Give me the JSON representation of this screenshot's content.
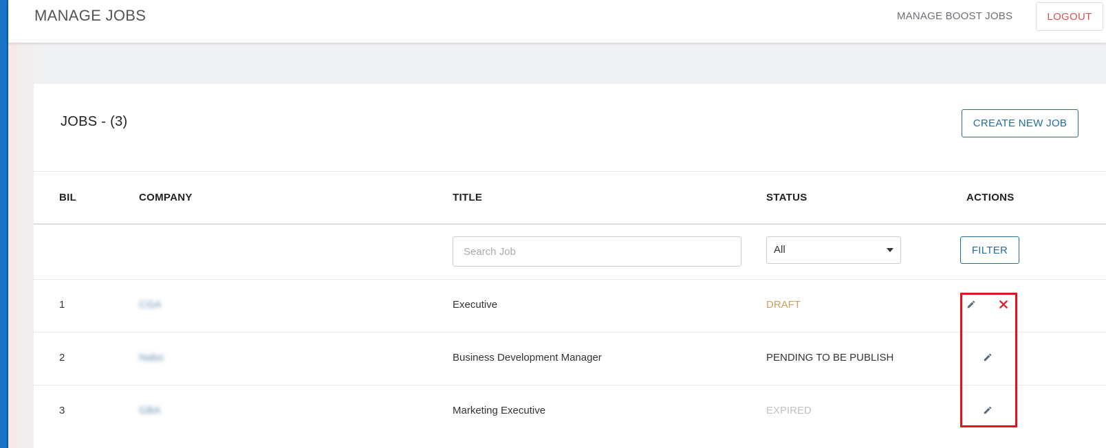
{
  "header": {
    "title": "MANAGE JOBS",
    "nav_boost": "MANAGE BOOST JOBS",
    "logout": "LOGOUT"
  },
  "jobs": {
    "heading": "JOBS - (3)",
    "create_button": "CREATE NEW JOB",
    "columns": {
      "bil": "BIL",
      "company": "COMPANY",
      "title": "TITLE",
      "status": "STATUS",
      "actions": "ACTIONS"
    },
    "filters": {
      "search_placeholder": "Search Job",
      "status_selected": "All",
      "filter_button": "FILTER"
    },
    "rows": [
      {
        "bil": "1",
        "company": "CGA",
        "title": "Executive",
        "status": "DRAFT",
        "actions": [
          "edit-icon",
          "delete-icon"
        ]
      },
      {
        "bil": "2",
        "company": "Nabo",
        "title": "Business Development Manager",
        "status": "PENDING TO BE PUBLISH",
        "actions": [
          "edit-icon"
        ]
      },
      {
        "bil": "3",
        "company": "GBA",
        "title": "Marketing Executive",
        "status": "EXPIRED",
        "actions": [
          "edit-icon"
        ]
      }
    ]
  },
  "colors": {
    "accent": "#1f6f9a",
    "logout": "#d9534f",
    "draft": "#c9a15b",
    "expired": "#c0c0c0",
    "highlight": "#e0141e"
  }
}
